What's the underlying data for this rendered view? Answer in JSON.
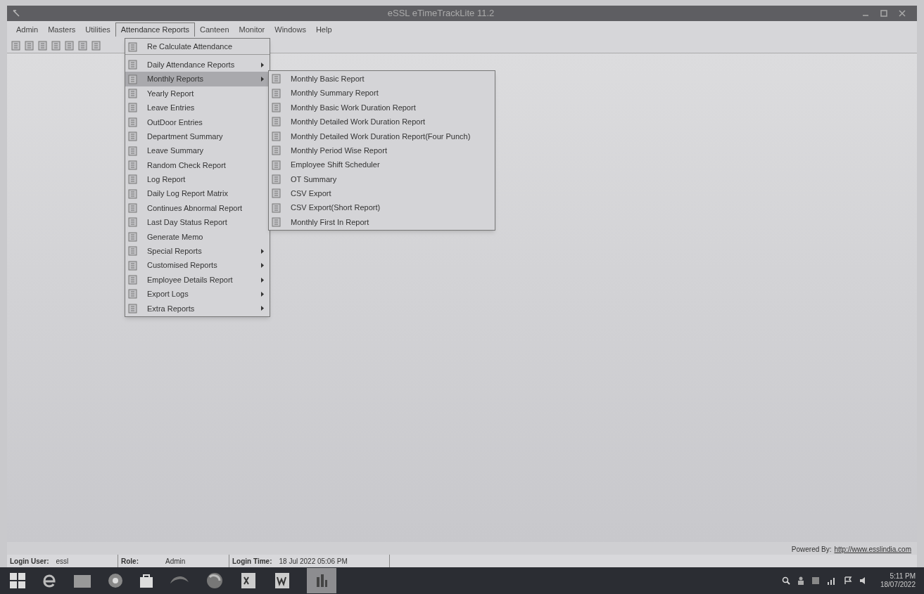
{
  "window": {
    "title": "eSSL eTimeTrackLite 11.2"
  },
  "menu_bar": [
    {
      "label": "Admin",
      "selected": false
    },
    {
      "label": "Masters",
      "selected": false
    },
    {
      "label": "Utilities",
      "selected": false
    },
    {
      "label": "Attendance Reports",
      "selected": true
    },
    {
      "label": "Canteen",
      "selected": false
    },
    {
      "label": "Monitor",
      "selected": false
    },
    {
      "label": "Windows",
      "selected": false
    },
    {
      "label": "Help",
      "selected": false
    }
  ],
  "attendance_menu": [
    {
      "label": "Re Calculate Attendance",
      "submenu": false,
      "selected": false,
      "separator_after": true
    },
    {
      "label": "Daily Attendance Reports",
      "submenu": true,
      "selected": false,
      "separator_after": false
    },
    {
      "label": "Monthly Reports",
      "submenu": true,
      "selected": true,
      "separator_after": false
    },
    {
      "label": "Yearly  Report",
      "submenu": false,
      "selected": false,
      "separator_after": false
    },
    {
      "label": "Leave Entries",
      "submenu": false,
      "selected": false,
      "separator_after": false
    },
    {
      "label": "OutDoor Entries",
      "submenu": false,
      "selected": false,
      "separator_after": false
    },
    {
      "label": "Department Summary",
      "submenu": false,
      "selected": false,
      "separator_after": false
    },
    {
      "label": "Leave Summary",
      "submenu": false,
      "selected": false,
      "separator_after": false
    },
    {
      "label": "Random Check Report",
      "submenu": false,
      "selected": false,
      "separator_after": false
    },
    {
      "label": "Log Report",
      "submenu": false,
      "selected": false,
      "separator_after": false
    },
    {
      "label": "Daily Log Report Matrix",
      "submenu": false,
      "selected": false,
      "separator_after": false
    },
    {
      "label": "Continues Abnormal Report",
      "submenu": false,
      "selected": false,
      "separator_after": false
    },
    {
      "label": "Last Day Status Report",
      "submenu": false,
      "selected": false,
      "separator_after": false
    },
    {
      "label": "Generate Memo",
      "submenu": false,
      "selected": false,
      "separator_after": false
    },
    {
      "label": "Special Reports",
      "submenu": true,
      "selected": false,
      "separator_after": false
    },
    {
      "label": "Customised Reports",
      "submenu": true,
      "selected": false,
      "separator_after": false
    },
    {
      "label": "Employee Details Report",
      "submenu": true,
      "selected": false,
      "separator_after": false
    },
    {
      "label": "Export Logs",
      "submenu": true,
      "selected": false,
      "separator_after": false
    },
    {
      "label": "Extra Reports",
      "submenu": true,
      "selected": false,
      "separator_after": false
    }
  ],
  "monthly_submenu": [
    {
      "label": "Monthly Basic Report"
    },
    {
      "label": "Monthly Summary Report"
    },
    {
      "label": "Monthly Basic Work Duration Report"
    },
    {
      "label": "Monthly Detailed Work Duration Report"
    },
    {
      "label": "Monthly Detailed Work Duration Report(Four Punch)"
    },
    {
      "label": "Monthly Period Wise Report"
    },
    {
      "label": "Employee Shift Scheduler"
    },
    {
      "label": "OT Summary"
    },
    {
      "label": "CSV Export"
    },
    {
      "label": "CSV Export(Short Report)"
    },
    {
      "label": "Monthly First In Report"
    }
  ],
  "powered_by": {
    "label": "Powered By:",
    "link": "http://www.esslindia.com"
  },
  "status_bar": [
    {
      "label": "Login User:",
      "value": "essl"
    },
    {
      "label": "Role:",
      "value": "Admin"
    },
    {
      "label": "Login Time:",
      "value": "18 Jul 2022 05:06 PM"
    }
  ],
  "taskbar": {
    "time": "5:11 PM",
    "date": "18/07/2022"
  }
}
